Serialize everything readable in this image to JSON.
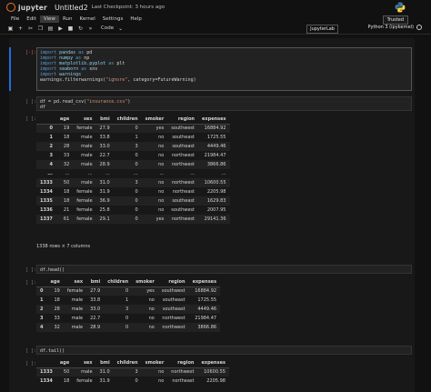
{
  "header": {
    "logo_text": "jupyter",
    "notebook_title": "Untitled2",
    "checkpoint": "Last Checkpoint: 3 hours ago",
    "trusted": "Trusted"
  },
  "menu": [
    "File",
    "Edit",
    "View",
    "Run",
    "Kernel",
    "Settings",
    "Help"
  ],
  "active_menu_index": 2,
  "toolbar": {
    "icons": [
      "save-icon",
      "add-icon",
      "cut-icon",
      "copy-icon",
      "paste-icon",
      "run-icon",
      "stop-icon",
      "restart-icon",
      "fast-forward-icon"
    ],
    "cell_type": "Code",
    "jupyterlab": "JupyterLab",
    "kernel": "Python 3 (ipykernel)"
  },
  "cells": {
    "c1": {
      "prompt": "[-]:",
      "lines": [
        "import pandas as pd",
        "import numpy as np",
        "import matplotlib.pyplot as plt",
        "import seaborn as sns",
        "import warnings",
        "warnings.filterwarnings(\"ignore\", category=FutureWarning)"
      ]
    },
    "c2": {
      "prompt": "[ ]:",
      "lines": [
        "df = pd.read_csv(\"insurance.csv\")",
        "df"
      ],
      "out_prompt": "[ ]:"
    },
    "c3": {
      "prompt": "[ ]:",
      "lines": [
        "df.head()"
      ],
      "out_prompt": "[ ]:"
    },
    "c4": {
      "prompt": "[ ]:",
      "lines": [
        "df.tail()"
      ],
      "out_prompt": "[ ]:"
    }
  },
  "columns": [
    "age",
    "sex",
    "bmi",
    "children",
    "smoker",
    "region",
    "expenses"
  ],
  "df_full": {
    "rows": [
      [
        "0",
        "19",
        "female",
        "27.9",
        "0",
        "yes",
        "southwest",
        "16884.92"
      ],
      [
        "1",
        "18",
        "male",
        "33.8",
        "1",
        "no",
        "southeast",
        "1725.55"
      ],
      [
        "2",
        "28",
        "male",
        "33.0",
        "3",
        "no",
        "southeast",
        "4449.46"
      ],
      [
        "3",
        "33",
        "male",
        "22.7",
        "0",
        "no",
        "northwest",
        "21984.47"
      ],
      [
        "4",
        "32",
        "male",
        "28.9",
        "0",
        "no",
        "northwest",
        "3866.86"
      ],
      [
        "...",
        "...",
        "...",
        "...",
        "...",
        "...",
        "...",
        "..."
      ],
      [
        "1333",
        "50",
        "male",
        "31.0",
        "3",
        "no",
        "northwest",
        "10600.55"
      ],
      [
        "1334",
        "18",
        "female",
        "31.9",
        "0",
        "no",
        "northeast",
        "2205.98"
      ],
      [
        "1335",
        "18",
        "female",
        "36.9",
        "0",
        "no",
        "southeast",
        "1629.83"
      ],
      [
        "1336",
        "21",
        "female",
        "25.8",
        "0",
        "no",
        "southwest",
        "2007.95"
      ],
      [
        "1337",
        "61",
        "female",
        "29.1",
        "0",
        "yes",
        "northwest",
        "29141.36"
      ]
    ],
    "shape": "1338 rows × 7 columns"
  },
  "df_head": {
    "rows": [
      [
        "0",
        "19",
        "female",
        "27.9",
        "0",
        "yes",
        "southwest",
        "16884.92"
      ],
      [
        "1",
        "18",
        "male",
        "33.8",
        "1",
        "no",
        "southeast",
        "1725.55"
      ],
      [
        "2",
        "28",
        "male",
        "33.0",
        "3",
        "no",
        "southeast",
        "4449.46"
      ],
      [
        "3",
        "33",
        "male",
        "22.7",
        "0",
        "no",
        "northwest",
        "21984.47"
      ],
      [
        "4",
        "32",
        "male",
        "28.9",
        "0",
        "no",
        "northwest",
        "3866.86"
      ]
    ]
  },
  "df_tail": {
    "rows": [
      [
        "1333",
        "50",
        "male",
        "31.0",
        "3",
        "no",
        "northwest",
        "10600.55"
      ],
      [
        "1334",
        "18",
        "female",
        "31.9",
        "0",
        "no",
        "northeast",
        "2205.98"
      ]
    ]
  }
}
